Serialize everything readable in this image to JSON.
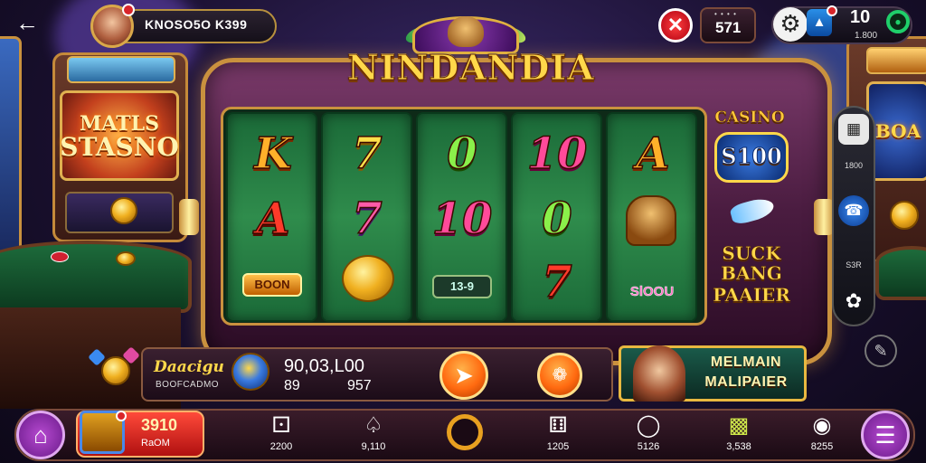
{
  "topbar": {
    "player_name": "KNOSO5O K399",
    "counter_top": "• • • •",
    "counter_value": "571",
    "level": "10",
    "level_sub": "1.800"
  },
  "machine": {
    "title": "NINDANDIA",
    "reels": [
      {
        "top": "K",
        "middle": "A",
        "bottom": "BOON"
      },
      {
        "top": "7",
        "middle": "7",
        "bottom": ""
      },
      {
        "top": "0",
        "middle": "10",
        "bottom": "13-9"
      },
      {
        "top": "10",
        "middle": "0",
        "bottom": "7"
      },
      {
        "top": "A",
        "middle": "",
        "bottom": "SlOOU"
      }
    ],
    "side_panel": {
      "casino_label": "CASINO",
      "casino_amount": "S100",
      "promo_line1": "SUCK",
      "promo_line2": "BANG",
      "promo_line3": "PAAIER"
    }
  },
  "left_machine": {
    "line1": "MATLS",
    "line2": "STASNO"
  },
  "right_machine": {
    "line1": "BOA"
  },
  "rail": {
    "label_1": "1800",
    "label_2": "S3R"
  },
  "bet_bar": {
    "title": "Daacigu",
    "subtitle": "BOOFCADMO",
    "amount": "90,03,L00",
    "stat_a": "89",
    "stat_b": "957"
  },
  "promo": {
    "line1": "MELMAIN",
    "line2": "MALIPAIER"
  },
  "bottom_nav": {
    "chest_value": "3910",
    "chest_label": "RaOM",
    "items": [
      {
        "label": "2200",
        "icon": "dice-icon"
      },
      {
        "label": "9,110",
        "icon": "cards-icon"
      },
      {
        "label": "",
        "icon": "ring-icon"
      },
      {
        "label": "1205",
        "icon": "dice-icon"
      },
      {
        "label": "5126",
        "icon": "pot-icon"
      },
      {
        "label": "3,538",
        "icon": "cash-icon"
      },
      {
        "label": "8255",
        "icon": "gamepad-icon"
      }
    ]
  },
  "colors": {
    "accent_gold": "#c9913e",
    "reel_green": "#2f8c4c",
    "frame_purple": "#4a1c40",
    "close_red": "#ff4040"
  }
}
